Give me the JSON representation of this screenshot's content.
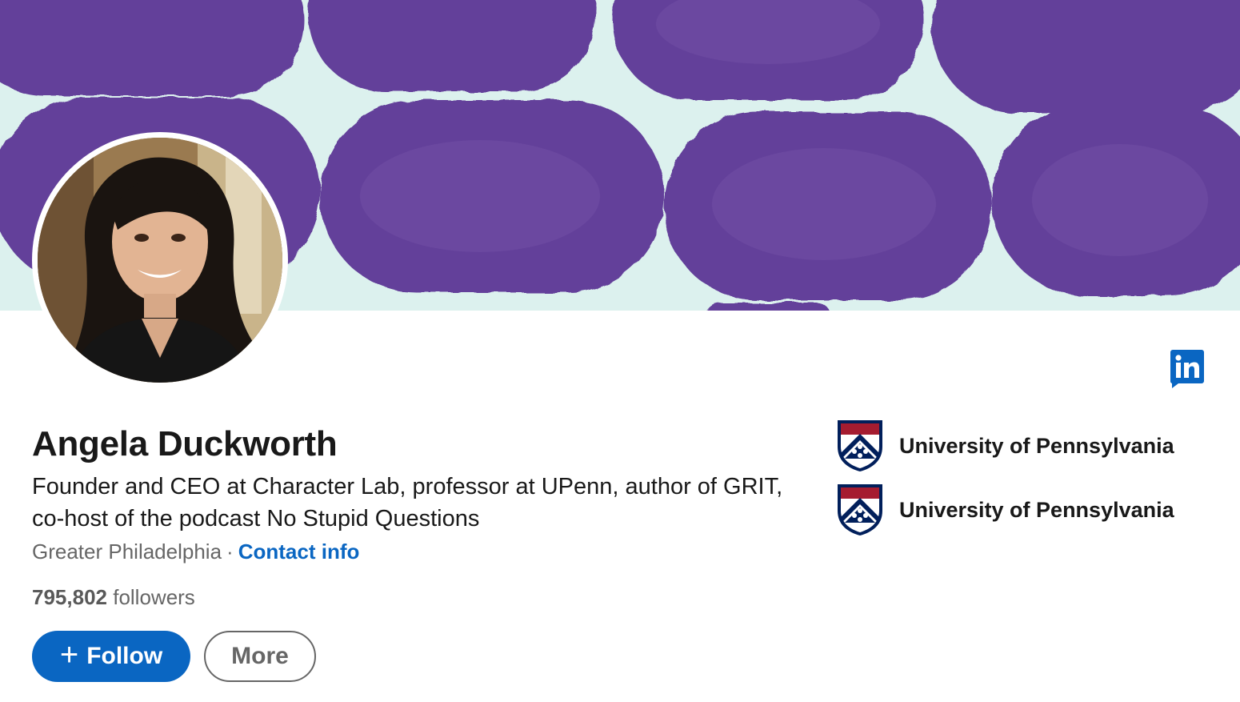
{
  "profile": {
    "name": "Angela Duckworth",
    "headline": "Founder and CEO at Character Lab, professor at UPenn, author of GRIT, co-host of the podcast No Stupid Questions",
    "location": "Greater Philadelphia",
    "separator": "·",
    "contact_label": "Contact info",
    "followers_count": "795,802",
    "followers_label": "followers"
  },
  "actions": {
    "follow_plus": "+",
    "follow_label": "Follow",
    "more_label": "More"
  },
  "education": [
    {
      "label": "University of Pennsylvania",
      "icon": "upenn-shield-icon"
    },
    {
      "label": "University of Pennsylvania",
      "icon": "upenn-shield-icon"
    }
  ],
  "icons": {
    "linkedin_badge": "linkedin-icon"
  },
  "colors": {
    "accent": "#0a66c2",
    "banner_background": "#dcf1ee",
    "banner_blobs": "#64419a",
    "text_primary": "#191919",
    "text_secondary": "#666666",
    "shield_red": "#a51c30",
    "shield_navy": "#011f5b"
  }
}
